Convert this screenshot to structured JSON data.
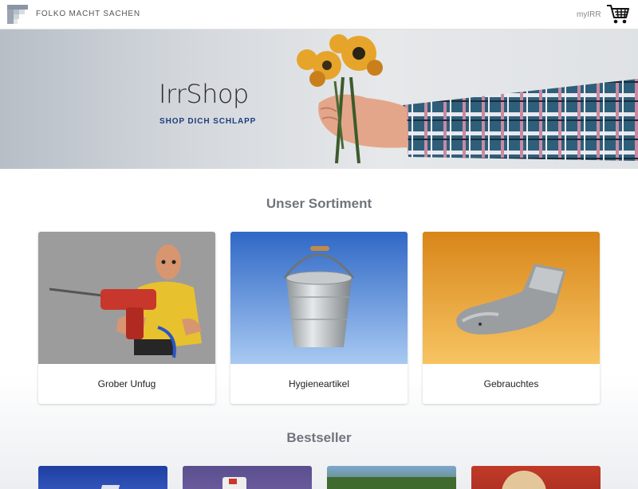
{
  "header": {
    "brand": "FOLKO MACHT SACHEN",
    "account_link": "myIRR"
  },
  "hero": {
    "title": "IrrShop",
    "subtitle": "SHOP DICH SCHLAPP"
  },
  "sortiment": {
    "heading": "Unser Sortiment",
    "categories": [
      {
        "label": "Grober Unfug"
      },
      {
        "label": "Hygieneartikel"
      },
      {
        "label": "Gebrauchtes"
      }
    ]
  },
  "bestseller": {
    "heading": "Bestseller"
  },
  "colors": {
    "brand_blue": "#1d3d7a",
    "card1_bg": "#9b9b9b",
    "card2_bg": "#4f86d4",
    "card3_bg": "#e8a43a"
  }
}
